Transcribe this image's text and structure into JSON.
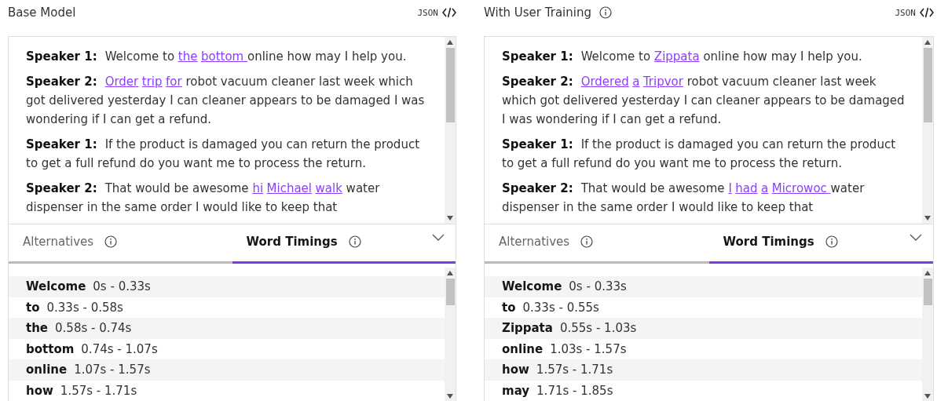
{
  "panels": [
    {
      "title": "Base Model",
      "info": false,
      "json_label": "JSON",
      "transcript": [
        {
          "speaker": "Speaker 1:",
          "parts": [
            {
              "text": "Welcome to "
            },
            {
              "text": "the",
              "flagged": true
            },
            {
              "text": "bottom ",
              "flagged": true
            },
            {
              "text": "online how may I help you."
            }
          ]
        },
        {
          "speaker": "Speaker 2:",
          "parts": [
            {
              "text": "Order",
              "flagged": true
            },
            {
              "text": "trip",
              "flagged": true
            },
            {
              "text": "for",
              "flagged": true
            },
            {
              "text": " robot vacuum cleaner last week which got delivered yesterday I can cleaner appears to be damaged I was wondering if I can get a refund."
            }
          ]
        },
        {
          "speaker": "Speaker 1:",
          "parts": [
            {
              "text": "If the product is damaged you can return the product to get a full refund do you want me to process the return."
            }
          ]
        },
        {
          "speaker": "Speaker 2:",
          "parts": [
            {
              "text": "That would be awesome "
            },
            {
              "text": "hi",
              "flagged": true
            },
            {
              "text": "Michael",
              "flagged": true
            },
            {
              "text": "walk",
              "flagged": true
            },
            {
              "text": " water dispenser in the same order I would like to keep that"
            }
          ]
        }
      ],
      "tabs": [
        {
          "label": "Alternatives",
          "selected": false
        },
        {
          "label": "Word Timings",
          "selected": true
        }
      ],
      "timings": [
        {
          "word": "Welcome",
          "time": "0s - 0.33s"
        },
        {
          "word": "to",
          "time": "0.33s - 0.58s"
        },
        {
          "word": "the",
          "time": "0.58s - 0.74s"
        },
        {
          "word": "bottom",
          "time": "0.74s - 1.07s"
        },
        {
          "word": "online",
          "time": "1.07s - 1.57s"
        },
        {
          "word": "how",
          "time": "1.57s - 1.71s"
        }
      ]
    },
    {
      "title": "With User Training",
      "info": true,
      "json_label": "JSON",
      "transcript": [
        {
          "speaker": "Speaker 1:",
          "parts": [
            {
              "text": "Welcome to "
            },
            {
              "text": "Zippata",
              "flagged": true
            },
            {
              "text": " online how may I help you."
            }
          ]
        },
        {
          "speaker": "Speaker 2:",
          "parts": [
            {
              "text": "Ordered",
              "flagged": true
            },
            {
              "text": "a",
              "flagged": true
            },
            {
              "text": "Tripvor",
              "flagged": true
            },
            {
              "text": " robot vacuum cleaner last week which got delivered yesterday I can cleaner appears to be damaged I was wondering if I can get a refund."
            }
          ]
        },
        {
          "speaker": "Speaker 1:",
          "parts": [
            {
              "text": "If the product is damaged you can return the product to get a full refund do you want me to process the return."
            }
          ]
        },
        {
          "speaker": "Speaker 2:",
          "parts": [
            {
              "text": "That would be awesome "
            },
            {
              "text": "I",
              "flagged": true
            },
            {
              "text": "had",
              "flagged": true
            },
            {
              "text": "a",
              "flagged": true
            },
            {
              "text": "Microwoc ",
              "flagged": true
            },
            {
              "text": "water dispenser in the same order I would like to keep that"
            }
          ]
        }
      ],
      "tabs": [
        {
          "label": "Alternatives",
          "selected": false
        },
        {
          "label": "Word Timings",
          "selected": true
        }
      ],
      "timings": [
        {
          "word": "Welcome",
          "time": "0s - 0.33s"
        },
        {
          "word": "to",
          "time": "0.33s - 0.55s"
        },
        {
          "word": "Zippata",
          "time": "0.55s - 1.03s"
        },
        {
          "word": "online",
          "time": "1.03s - 1.57s"
        },
        {
          "word": "how",
          "time": "1.57s - 1.71s"
        },
        {
          "word": "may",
          "time": "1.71s - 1.85s"
        }
      ]
    }
  ]
}
